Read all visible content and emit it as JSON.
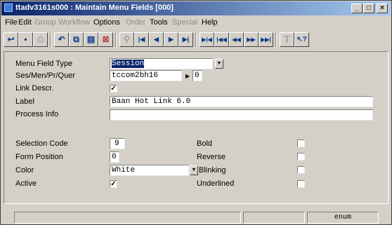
{
  "window": {
    "title": "ttadv3161s000 : Maintain Menu Fields [000]"
  },
  "title_buttons": {
    "minimize": "_",
    "maximize": "□",
    "close": "×"
  },
  "menu": {
    "file": "File",
    "edit": "Edit",
    "group": "Group",
    "workflow": "Workflow",
    "options": "Options",
    "order": "Order",
    "tools": "Tools",
    "special": "Special",
    "help": "Help"
  },
  "toolbar": {
    "icons": [
      "exit-icon",
      "save-icon",
      "print-icon",
      "undo-icon",
      "copy-record-icon",
      "paste-icon",
      "delete-icon",
      "find-icon",
      "first-record-icon",
      "previous-record-icon",
      "next-record-icon",
      "last-record-icon",
      "first-group-icon",
      "previous-group-icon",
      "previous-page-icon",
      "next-page-icon",
      "last-group-icon",
      "text-icon",
      "help-pointer-icon"
    ],
    "glyphs": {
      "exit": "↩",
      "save": "▪",
      "print": "⎙",
      "undo": "↶",
      "copy": "⧉",
      "paste": "▤",
      "delete": "⊠",
      "find": "⚲",
      "first": "|◀",
      "prev": "◀",
      "next": "▶",
      "last": "▶|",
      "first_group": "▶|◀",
      "prev_group": "|◀◀",
      "prev_page": "◀◀",
      "next_page": "▶▶",
      "last_group": "▶▶|",
      "text": "T",
      "help": "↖?"
    }
  },
  "form": {
    "menu_field_type": {
      "label": "Menu Field Type",
      "value": "Session"
    },
    "ses_men_pr_quer": {
      "label": "Ses/Men/Pr/Quer",
      "value": "tccom2bh16",
      "extra": "0"
    },
    "link_descr": {
      "label": "Link Descr.",
      "checked": true
    },
    "label": {
      "label": "Label",
      "value": "Baan Hot Link 6.0"
    },
    "process_info": {
      "label": "Process Info",
      "value": ""
    },
    "selection_code": {
      "label": "Selection Code",
      "value": "9"
    },
    "form_position": {
      "label": "Form Position",
      "value": "0"
    },
    "color": {
      "label": "Color",
      "value": "White"
    },
    "active": {
      "label": "Active",
      "checked": true
    },
    "bold": {
      "label": "Bold",
      "checked": false
    },
    "reverse": {
      "label": "Reverse",
      "checked": false
    },
    "blinking": {
      "label": "Blinking",
      "checked": false
    },
    "underlined": {
      "label": "Underlined",
      "checked": false
    }
  },
  "check_glyph": "✓",
  "dropdown_glyph": "▼",
  "arrow_glyph": "▶",
  "status": {
    "cell_1": "",
    "cell_2": "",
    "cell_3": "enum"
  }
}
